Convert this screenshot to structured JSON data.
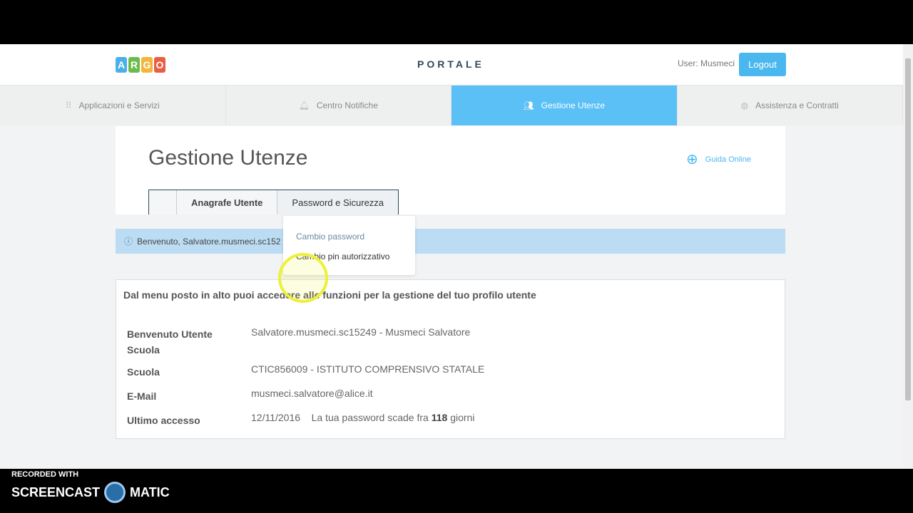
{
  "header": {
    "logo": [
      "A",
      "R",
      "G",
      "O"
    ],
    "logo_colors": [
      "#4ab0e8",
      "#6cbb4e",
      "#f3b53b",
      "#e95d43"
    ],
    "title": "PORTALE",
    "user": "User: Musmeci",
    "logout": "Logout"
  },
  "nav": [
    {
      "label": "Applicazioni e Servizi",
      "icon": "grid-icon"
    },
    {
      "label": "Centro Notifiche",
      "icon": "bell-icon"
    },
    {
      "label": "Gestione Utenze",
      "icon": "users-icon",
      "active": true
    },
    {
      "label": "Assistenza e Contratti",
      "icon": "support-icon"
    }
  ],
  "page": {
    "title": "Gestione Utenze",
    "guida": "Guida Online",
    "tabs": [
      "Anagrafe Utente",
      "Password e Sicurezza"
    ]
  },
  "alert": "Benvenuto, Salvatore.musmeci.sc152",
  "menu": [
    "Cambio password",
    "Cambio pin autorizzativo"
  ],
  "info": {
    "intro": "Dal menu posto in alto puoi accedere alle funzioni per la gestione del tuo profilo utente",
    "rows": [
      {
        "label": "Benvenuto Utente Scuola",
        "value": "Salvatore.musmeci.sc15249 - Musmeci Salvatore"
      },
      {
        "label": "Scuola",
        "value": "CTIC856009 - ISTITUTO COMPRENSIVO STATALE"
      },
      {
        "label": "E-Mail",
        "value": "musmeci.salvatore@alice.it"
      },
      {
        "label": "Ultimo accesso",
        "value": "12/11/2016"
      }
    ],
    "expiry_pre": "La tua password scade fra",
    "expiry_days": "118",
    "expiry_post": "giorni"
  },
  "watermark": {
    "line1": "RECORDED WITH",
    "line2": "SCREENCAST",
    "line3": "MATIC"
  }
}
